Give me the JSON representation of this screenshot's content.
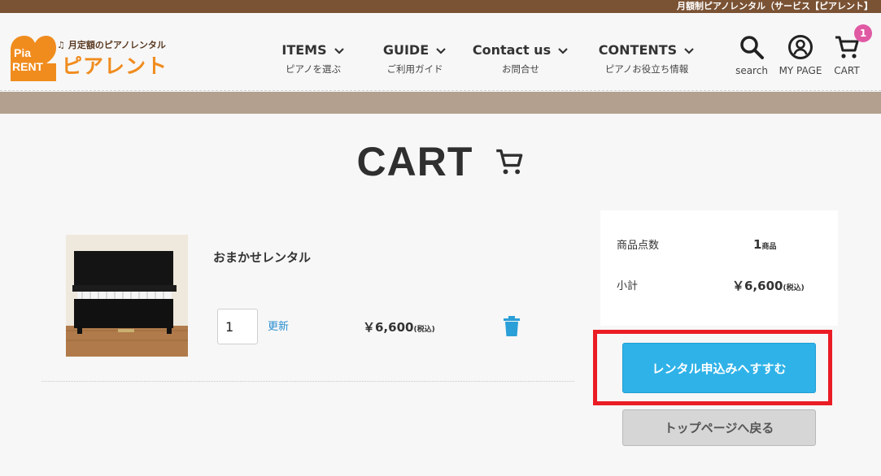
{
  "topbar": {
    "text": "月額制ピアノレンタル（サービス【ピアレント】"
  },
  "logo": {
    "badge_line1": "Pia",
    "badge_line2": "RENT",
    "tagline": "月定額のピアノレンタル",
    "tagline_icon": "music-note",
    "name": "ピアレント",
    "brand_color": "#f08c1e"
  },
  "nav": [
    {
      "label": "ITEMS",
      "sub": "ピアノを選ぶ"
    },
    {
      "label": "GUIDE",
      "sub": "ご利用ガイド"
    },
    {
      "label": "Contact us",
      "sub": "お問合せ"
    },
    {
      "label": "CONTENTS",
      "sub": "ピアノお役立ち情報"
    }
  ],
  "header_icons": {
    "search": {
      "label": "search",
      "icon": "search-icon"
    },
    "mypage": {
      "label": "MY PAGE",
      "icon": "user-circle-icon"
    },
    "cart": {
      "label": "CART",
      "icon": "cart-icon",
      "badge": "1"
    }
  },
  "page": {
    "title": "CART"
  },
  "cart_item": {
    "name": "おまかせレンタル",
    "quantity": "1",
    "update_label": "更新",
    "price": "￥6,600",
    "tax_note": "(税込)"
  },
  "summary": {
    "count_label": "商品点数",
    "count_value": "1",
    "count_unit": "商品",
    "subtotal_label": "小計",
    "subtotal_value": "￥6,600",
    "subtotal_tax": "(税込)"
  },
  "actions": {
    "apply_label": "レンタル申込みへすすむ",
    "back_label": "トップページへ戻る"
  },
  "colors": {
    "topbar": "#7a5234",
    "band": "#b4a08f",
    "accent_blue": "#2fb2e8",
    "highlight_red": "#ea1c24",
    "badge_pink": "#e05aa3"
  }
}
